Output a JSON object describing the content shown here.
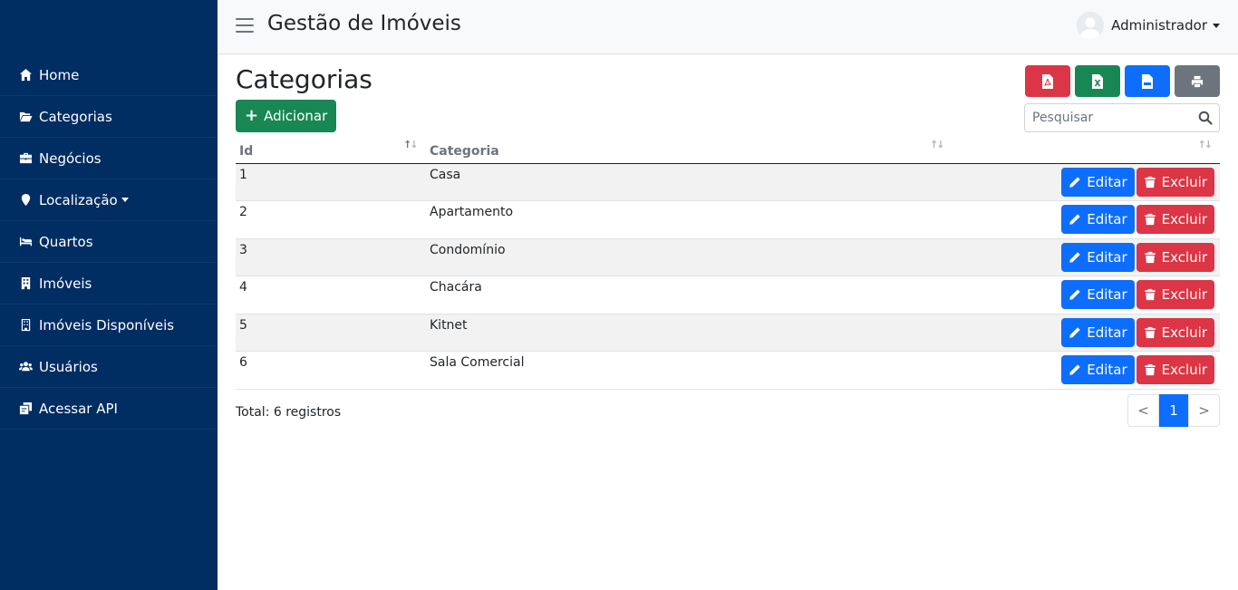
{
  "app": {
    "title": "Gestão de Imóveis"
  },
  "user": {
    "name": "Administrador"
  },
  "sidebar": {
    "items": [
      {
        "label": "Home",
        "icon": "home-icon"
      },
      {
        "label": "Categorias",
        "icon": "folder-open-icon"
      },
      {
        "label": "Negócios",
        "icon": "briefcase-icon"
      },
      {
        "label": "Localização",
        "icon": "map-marker-icon",
        "has_dropdown": true
      },
      {
        "label": "Quartos",
        "icon": "bed-icon"
      },
      {
        "label": "Imóveis",
        "icon": "building-icon"
      },
      {
        "label": "Imóveis Disponíveis",
        "icon": "building-outline-icon"
      },
      {
        "label": "Usuários",
        "icon": "users-icon"
      },
      {
        "label": "Acessar API",
        "icon": "api-icon"
      }
    ]
  },
  "page": {
    "title": "Categorias",
    "add_label": "Adicionar",
    "search_placeholder": "Pesquisar",
    "export_buttons": [
      "pdf-icon",
      "excel-icon",
      "csv-icon",
      "print-icon"
    ]
  },
  "table": {
    "columns": [
      "Id",
      "Categoria",
      ""
    ],
    "rows": [
      {
        "id": "1",
        "categoria": "Casa"
      },
      {
        "id": "2",
        "categoria": "Apartamento"
      },
      {
        "id": "3",
        "categoria": "Condomínio"
      },
      {
        "id": "4",
        "categoria": "Chacára"
      },
      {
        "id": "5",
        "categoria": "Kitnet"
      },
      {
        "id": "6",
        "categoria": "Sala Comercial"
      }
    ],
    "edit_label": "Editar",
    "delete_label": "Excluir"
  },
  "footer": {
    "total_label": "Total: 6 registros",
    "pagination": {
      "prev": "<",
      "current": "1",
      "next": ">"
    }
  },
  "colors": {
    "sidebar": "#002d62",
    "primary": "#0d6efd",
    "success": "#198754",
    "danger": "#dc3545",
    "secondary": "#6c757d"
  }
}
